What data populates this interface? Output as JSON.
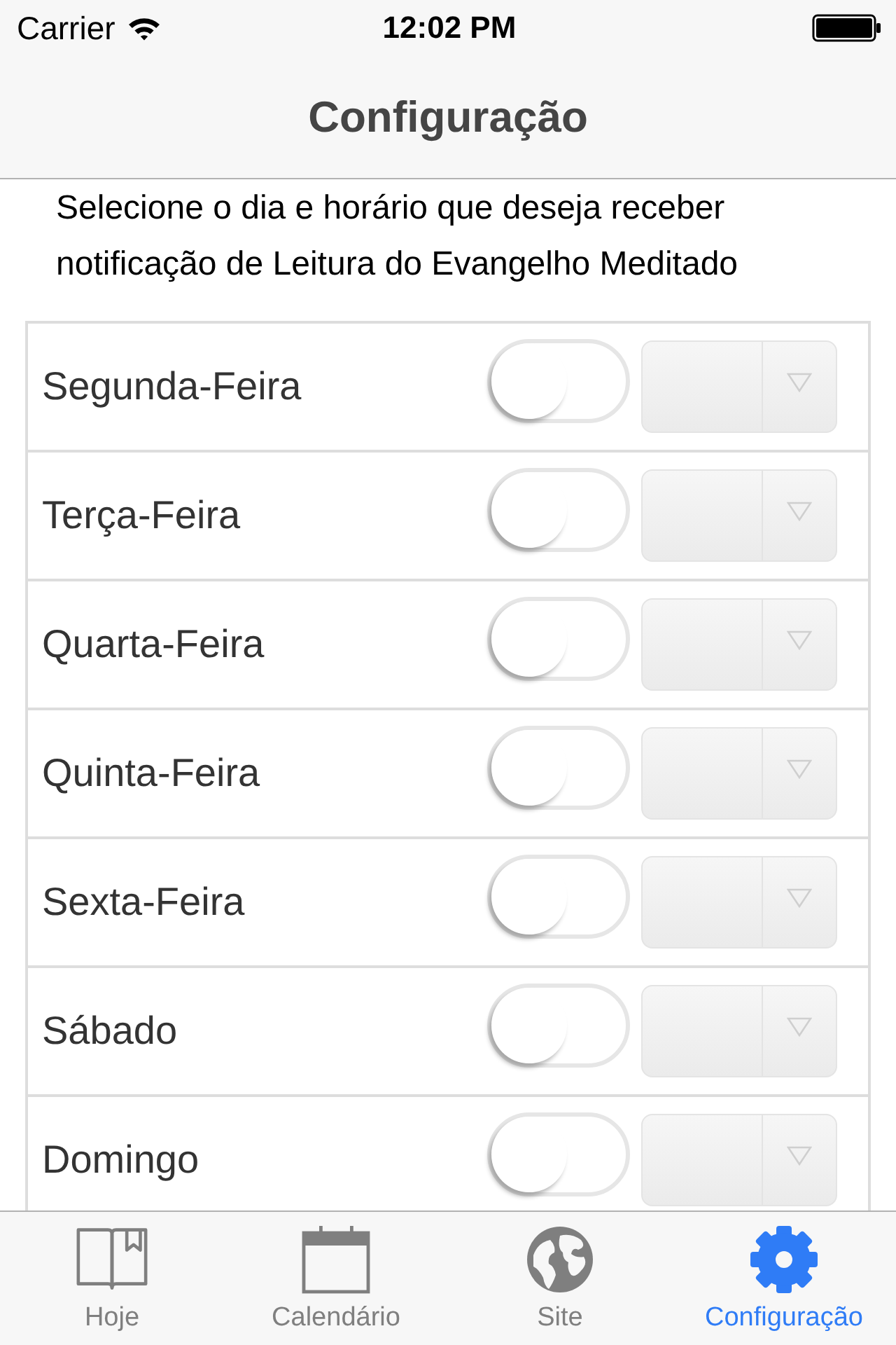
{
  "status_bar": {
    "carrier": "Carrier",
    "time": "12:02 PM"
  },
  "nav_bar": {
    "title": "Configuração"
  },
  "instructions": "Selecione o dia e horário que deseja receber notificação de Leitura do Evangelho Meditado",
  "days": [
    {
      "label": "Segunda-Feira",
      "on": false
    },
    {
      "label": "Terça-Feira",
      "on": false
    },
    {
      "label": "Quarta-Feira",
      "on": false
    },
    {
      "label": "Quinta-Feira",
      "on": false
    },
    {
      "label": "Sexta-Feira",
      "on": false
    },
    {
      "label": "Sábado",
      "on": false
    },
    {
      "label": "Domingo",
      "on": false
    }
  ],
  "tab_bar": [
    {
      "label": "Hoje",
      "selected": false
    },
    {
      "label": "Calendário",
      "selected": false
    },
    {
      "label": "Site",
      "selected": false
    },
    {
      "label": "Configuração",
      "selected": true
    }
  ]
}
